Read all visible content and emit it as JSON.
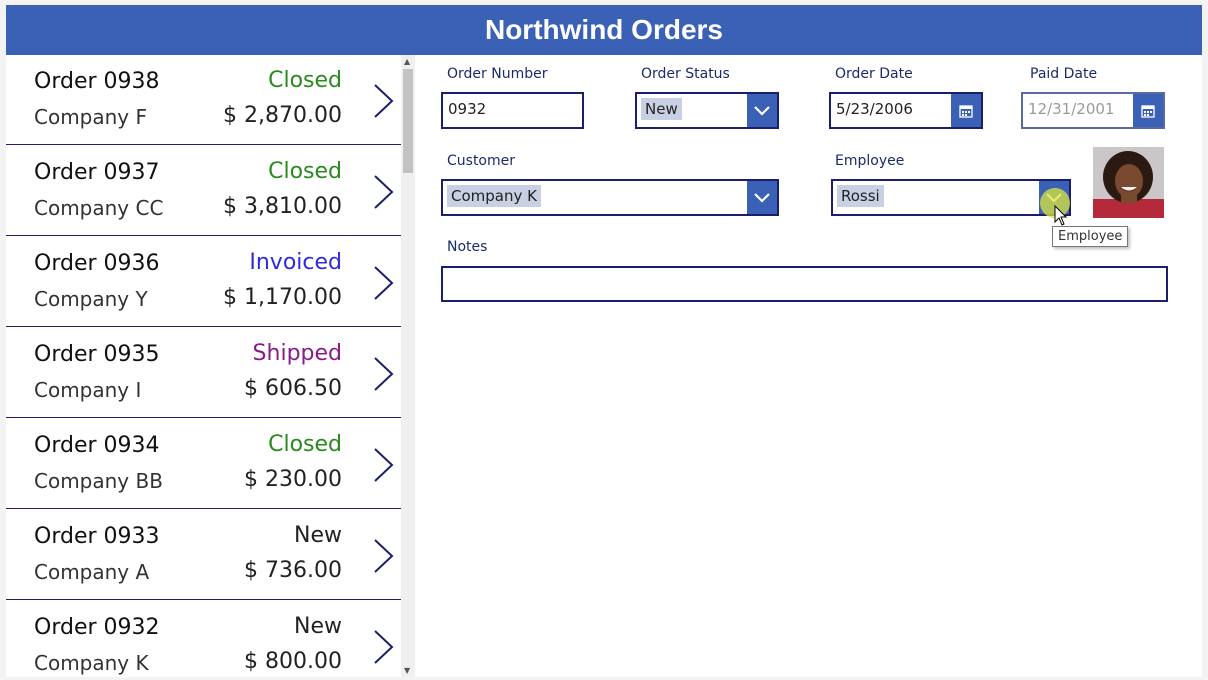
{
  "app": {
    "title": "Northwind Orders"
  },
  "colors": {
    "header": "#3a61b5",
    "border": "#1b1f6b",
    "closed": "#2a8a1f",
    "invoiced": "#2d2be0",
    "shipped": "#8a1b8a",
    "new": "#222222"
  },
  "orders": [
    {
      "number": "Order 0938",
      "company": "Company F",
      "status": "Closed",
      "status_color": "#2a8a1f",
      "amount": "$ 2,870.00"
    },
    {
      "number": "Order 0937",
      "company": "Company CC",
      "status": "Closed",
      "status_color": "#2a8a1f",
      "amount": "$ 3,810.00"
    },
    {
      "number": "Order 0936",
      "company": "Company Y",
      "status": "Invoiced",
      "status_color": "#2d2be0",
      "amount": "$ 1,170.00"
    },
    {
      "number": "Order 0935",
      "company": "Company I",
      "status": "Shipped",
      "status_color": "#8a1b8a",
      "amount": "$ 606.50"
    },
    {
      "number": "Order 0934",
      "company": "Company BB",
      "status": "Closed",
      "status_color": "#2a8a1f",
      "amount": "$ 230.00"
    },
    {
      "number": "Order 0933",
      "company": "Company A",
      "status": "New",
      "status_color": "#222222",
      "amount": "$ 736.00"
    },
    {
      "number": "Order 0932",
      "company": "Company K",
      "status": "New",
      "status_color": "#222222",
      "amount": "$ 800.00"
    }
  ],
  "form": {
    "order_number": {
      "label": "Order Number",
      "value": "0932"
    },
    "order_status": {
      "label": "Order Status",
      "value": "New"
    },
    "order_date": {
      "label": "Order Date",
      "value": "5/23/2006"
    },
    "paid_date": {
      "label": "Paid Date",
      "value": "12/31/2001"
    },
    "customer": {
      "label": "Customer",
      "value": "Company K"
    },
    "employee": {
      "label": "Employee",
      "value": "Rossi"
    },
    "notes": {
      "label": "Notes",
      "value": ""
    }
  },
  "tooltip": {
    "text": "Employee"
  },
  "icons": {
    "chevron": "chevron-right-icon",
    "dropdown": "chevron-down-icon",
    "calendar": "calendar-icon",
    "cursor": "mouse-pointer-icon"
  }
}
